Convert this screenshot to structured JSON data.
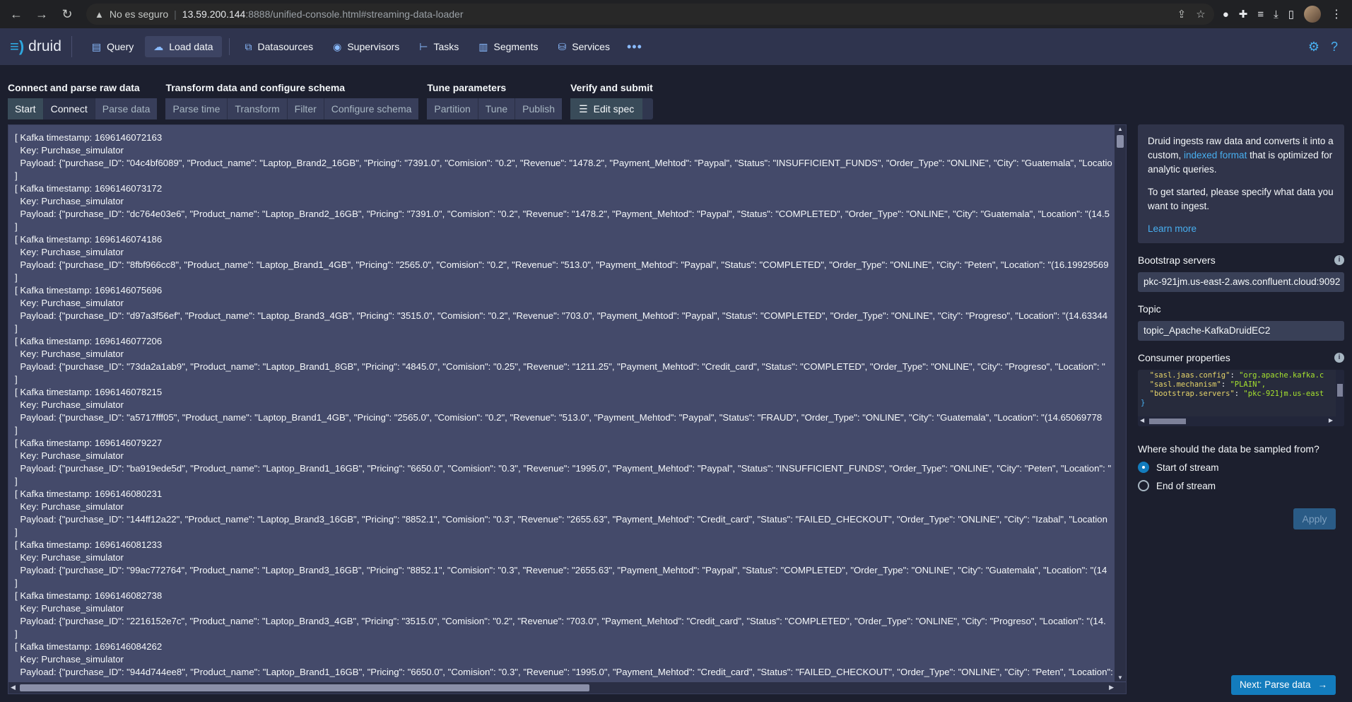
{
  "browser": {
    "security_label": "No es seguro",
    "host": "13.59.200.144",
    "path": ":8888/unified-console.html#streaming-data-loader"
  },
  "nav": {
    "brand": "druid",
    "items": [
      {
        "label": "Query",
        "icon": "console-icon"
      },
      {
        "label": "Load data",
        "icon": "cloud-upload-icon"
      },
      {
        "label": "Datasources",
        "icon": "multi-select-icon"
      },
      {
        "label": "Supervisors",
        "icon": "eye-open-icon"
      },
      {
        "label": "Tasks",
        "icon": "gantt-chart-icon"
      },
      {
        "label": "Segments",
        "icon": "stacked-chart-icon"
      },
      {
        "label": "Services",
        "icon": "database-icon"
      }
    ],
    "more": "•••"
  },
  "steps": {
    "group1": {
      "title": "Connect and parse raw data",
      "buttons": [
        "Start",
        "Connect",
        "Parse data"
      ]
    },
    "group2": {
      "title": "Transform data and configure schema",
      "buttons": [
        "Parse time",
        "Transform",
        "Filter",
        "Configure schema"
      ]
    },
    "group3": {
      "title": "Tune parameters",
      "buttons": [
        "Partition",
        "Tune",
        "Publish"
      ]
    },
    "group4": {
      "title": "Verify and submit",
      "buttons": [
        "Edit spec"
      ]
    }
  },
  "raw_data": [
    {
      "ts": "[ Kafka timestamp: 1696146072163",
      "key": "  Key: Purchase_simulator",
      "payload": "  Payload: {\"purchase_ID\": \"04c4bf6089\", \"Product_name\": \"Laptop_Brand2_16GB\", \"Pricing\": \"7391.0\", \"Comision\": \"0.2\", \"Revenue\": \"1478.2\", \"Payment_Mehtod\": \"Paypal\", \"Status\": \"INSUFFICIENT_FUNDS\", \"Order_Type\": \"ONLINE\", \"City\": \"Guatemala\", \"Locatio"
    },
    {
      "ts": "[ Kafka timestamp: 1696146073172",
      "key": "  Key: Purchase_simulator",
      "payload": "  Payload: {\"purchase_ID\": \"dc764e03e6\", \"Product_name\": \"Laptop_Brand2_16GB\", \"Pricing\": \"7391.0\", \"Comision\": \"0.2\", \"Revenue\": \"1478.2\", \"Payment_Mehtod\": \"Paypal\", \"Status\": \"COMPLETED\", \"Order_Type\": \"ONLINE\", \"City\": \"Guatemala\", \"Location\": \"(14.5"
    },
    {
      "ts": "[ Kafka timestamp: 1696146074186",
      "key": "  Key: Purchase_simulator",
      "payload": "  Payload: {\"purchase_ID\": \"8fbf966cc8\", \"Product_name\": \"Laptop_Brand1_4GB\", \"Pricing\": \"2565.0\", \"Comision\": \"0.2\", \"Revenue\": \"513.0\", \"Payment_Mehtod\": \"Paypal\", \"Status\": \"COMPLETED\", \"Order_Type\": \"ONLINE\", \"City\": \"Peten\", \"Location\": \"(16.19929569"
    },
    {
      "ts": "[ Kafka timestamp: 1696146075696",
      "key": "  Key: Purchase_simulator",
      "payload": "  Payload: {\"purchase_ID\": \"d97a3f56ef\", \"Product_name\": \"Laptop_Brand3_4GB\", \"Pricing\": \"3515.0\", \"Comision\": \"0.2\", \"Revenue\": \"703.0\", \"Payment_Mehtod\": \"Paypal\", \"Status\": \"COMPLETED\", \"Order_Type\": \"ONLINE\", \"City\": \"Progreso\", \"Location\": \"(14.63344"
    },
    {
      "ts": "[ Kafka timestamp: 1696146077206",
      "key": "  Key: Purchase_simulator",
      "payload": "  Payload: {\"purchase_ID\": \"73da2a1ab9\", \"Product_name\": \"Laptop_Brand1_8GB\", \"Pricing\": \"4845.0\", \"Comision\": \"0.25\", \"Revenue\": \"1211.25\", \"Payment_Mehtod\": \"Credit_card\", \"Status\": \"COMPLETED\", \"Order_Type\": \"ONLINE\", \"City\": \"Progreso\", \"Location\": \""
    },
    {
      "ts": "[ Kafka timestamp: 1696146078215",
      "key": "  Key: Purchase_simulator",
      "payload": "  Payload: {\"purchase_ID\": \"a5717fff05\", \"Product_name\": \"Laptop_Brand1_4GB\", \"Pricing\": \"2565.0\", \"Comision\": \"0.2\", \"Revenue\": \"513.0\", \"Payment_Mehtod\": \"Paypal\", \"Status\": \"FRAUD\", \"Order_Type\": \"ONLINE\", \"City\": \"Guatemala\", \"Location\": \"(14.65069778"
    },
    {
      "ts": "[ Kafka timestamp: 1696146079227",
      "key": "  Key: Purchase_simulator",
      "payload": "  Payload: {\"purchase_ID\": \"ba919ede5d\", \"Product_name\": \"Laptop_Brand1_16GB\", \"Pricing\": \"6650.0\", \"Comision\": \"0.3\", \"Revenue\": \"1995.0\", \"Payment_Mehtod\": \"Paypal\", \"Status\": \"INSUFFICIENT_FUNDS\", \"Order_Type\": \"ONLINE\", \"City\": \"Peten\", \"Location\": \""
    },
    {
      "ts": "[ Kafka timestamp: 1696146080231",
      "key": "  Key: Purchase_simulator",
      "payload": "  Payload: {\"purchase_ID\": \"144ff12a22\", \"Product_name\": \"Laptop_Brand3_16GB\", \"Pricing\": \"8852.1\", \"Comision\": \"0.3\", \"Revenue\": \"2655.63\", \"Payment_Mehtod\": \"Credit_card\", \"Status\": \"FAILED_CHECKOUT\", \"Order_Type\": \"ONLINE\", \"City\": \"Izabal\", \"Location"
    },
    {
      "ts": "[ Kafka timestamp: 1696146081233",
      "key": "  Key: Purchase_simulator",
      "payload": "  Payload: {\"purchase_ID\": \"99ac772764\", \"Product_name\": \"Laptop_Brand3_16GB\", \"Pricing\": \"8852.1\", \"Comision\": \"0.3\", \"Revenue\": \"2655.63\", \"Payment_Mehtod\": \"Paypal\", \"Status\": \"COMPLETED\", \"Order_Type\": \"ONLINE\", \"City\": \"Guatemala\", \"Location\": \"(14"
    },
    {
      "ts": "[ Kafka timestamp: 1696146082738",
      "key": "  Key: Purchase_simulator",
      "payload": "  Payload: {\"purchase_ID\": \"2216152e7c\", \"Product_name\": \"Laptop_Brand3_4GB\", \"Pricing\": \"3515.0\", \"Comision\": \"0.2\", \"Revenue\": \"703.0\", \"Payment_Mehtod\": \"Credit_card\", \"Status\": \"COMPLETED\", \"Order_Type\": \"ONLINE\", \"City\": \"Progreso\", \"Location\": \"(14."
    },
    {
      "ts": "[ Kafka timestamp: 1696146084262",
      "key": "  Key: Purchase_simulator",
      "payload": "  Payload: {\"purchase_ID\": \"944d744ee8\", \"Product_name\": \"Laptop_Brand1_16GB\", \"Pricing\": \"6650.0\", \"Comision\": \"0.3\", \"Revenue\": \"1995.0\", \"Payment_Mehtod\": \"Credit_card\", \"Status\": \"FAILED_CHECKOUT\", \"Order_Type\": \"ONLINE\", \"City\": \"Peten\", \"Location\": "
    }
  ],
  "side": {
    "intro_1a": "Druid ingests raw data and converts it into a custom, ",
    "intro_link": "indexed format",
    "intro_1b": " that is optimized for analytic queries.",
    "intro_2": "To get started, please specify what data you want to ingest.",
    "learn_more": "Learn more",
    "bootstrap_label": "Bootstrap servers",
    "bootstrap_value": "pkc-921jm.us-east-2.aws.confluent.cloud:9092",
    "topic_label": "Topic",
    "topic_value": "topic_Apache-KafkaDruidEC2",
    "consumer_label": "Consumer properties",
    "consumer_lines": [
      {
        "k": "\"sasl.jaas.config\"",
        "v": "\"org.apache.kafka.c"
      },
      {
        "k": "\"sasl.mechanism\"",
        "v": "\"PLAIN\","
      },
      {
        "k": "\"bootstrap.servers\"",
        "v": "\"pkc-921jm.us-east"
      }
    ],
    "sample_question": "Where should the data be sampled from?",
    "sample_options": [
      "Start of stream",
      "End of stream"
    ],
    "apply": "Apply",
    "next": "Next: Parse data"
  },
  "colors": {
    "accent": "#137cbd",
    "link": "#48aff0",
    "bg": "#1c1f2e",
    "nav": "#2f344e"
  }
}
